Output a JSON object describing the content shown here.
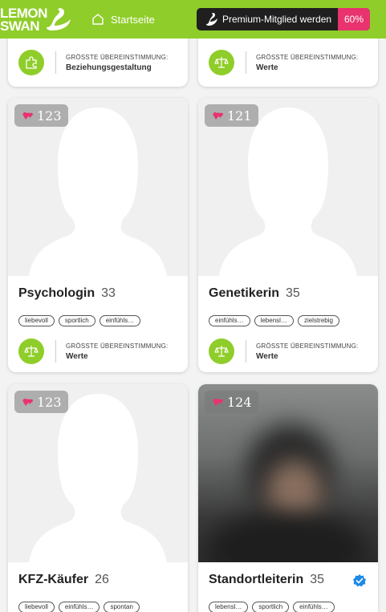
{
  "header": {
    "logo_line1": "LEMON",
    "logo_line2": "SWAN",
    "home_label": "Startseite",
    "premium_label": "Premium-Mitglied werden",
    "premium_percent": "60%"
  },
  "colors": {
    "brand_green": "#8fcd2a",
    "accent_pink": "#e8336f",
    "verified_blue": "#1e88e5"
  },
  "match_caption": "GRÖSSTE ÜBEREINSTIMMUNG:",
  "top_cards": [
    {
      "match_value": "Beziehungsgestaltung",
      "match_icon": "puzzle-icon"
    },
    {
      "match_value": "Werte",
      "match_icon": "scale-icon"
    }
  ],
  "cards": [
    {
      "score": "123",
      "name": "Psychologin",
      "age": "33",
      "tags": [
        "liebevoll",
        "sportlich",
        "einfühls…"
      ],
      "match_value": "Werte",
      "verified": false,
      "photo": "placeholder"
    },
    {
      "score": "121",
      "name": "Genetikerin",
      "age": "35",
      "tags": [
        "einfühls…",
        "lebensl…",
        "zielstrebig"
      ],
      "match_value": "Werte",
      "verified": false,
      "photo": "placeholder"
    },
    {
      "score": "123",
      "name": "KFZ-Käufer",
      "age": "26",
      "tags": [
        "liebevoll",
        "einfühls…",
        "spontan"
      ],
      "match_value": "",
      "verified": false,
      "photo": "placeholder"
    },
    {
      "score": "124",
      "name": "Standortleiterin",
      "age": "35",
      "tags": [
        "lebensl…",
        "sportlich",
        "einfühls…"
      ],
      "match_value": "",
      "verified": true,
      "photo": "blurred"
    }
  ]
}
